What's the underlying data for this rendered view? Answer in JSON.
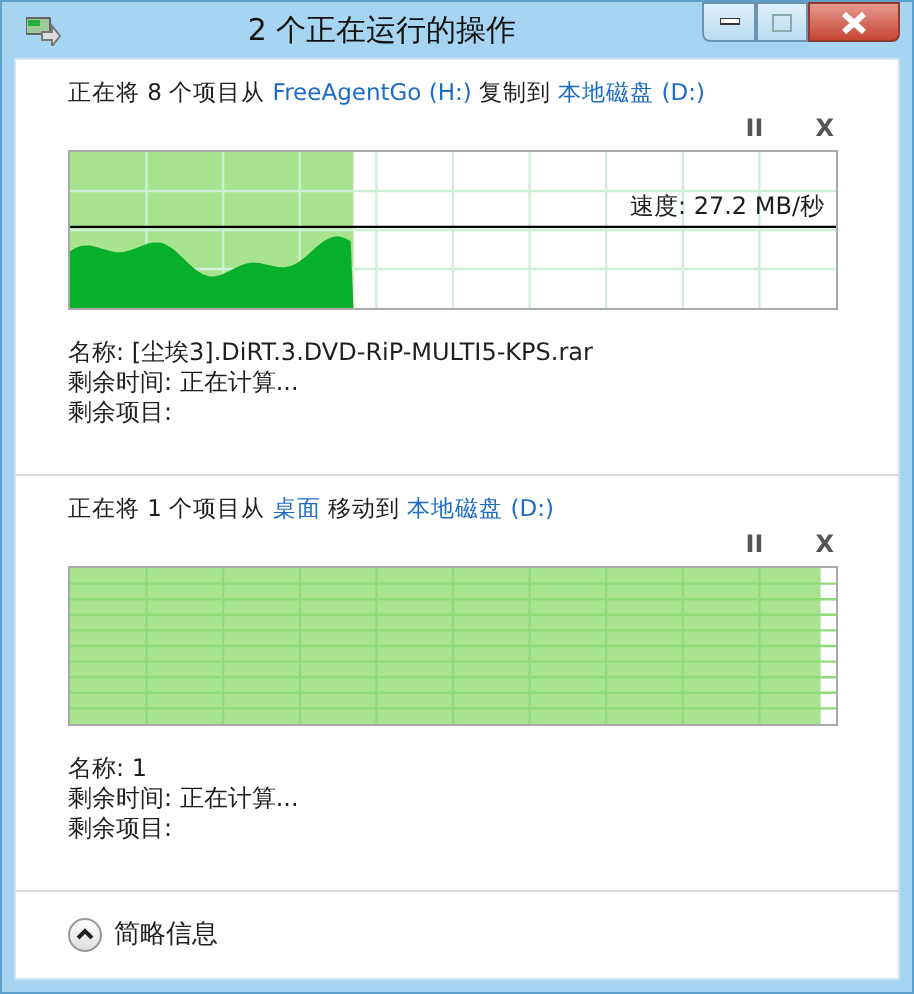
{
  "window": {
    "title": "2 个正在运行的操作"
  },
  "operations": [
    {
      "kind": "graph",
      "title": [
        {
          "text": "正在将 8 个项目从 ",
          "kind": "plain"
        },
        {
          "text": "FreeAgentGo (H:)",
          "kind": "link"
        },
        {
          "text": " 复制到 ",
          "kind": "plain"
        },
        {
          "text": "本地磁盘 (D:)",
          "kind": "link"
        }
      ],
      "pause": "II",
      "cancel": "X",
      "level": 0.37,
      "speed": "速度: 27.2 MB/秒",
      "details": [
        "名称: [尘埃3].DiRT.3.DVD-RiP-MULTI5-KPS.rar",
        "剩余时间: 正在计算...",
        "剩余项目:"
      ]
    },
    {
      "kind": "bar",
      "title": [
        {
          "text": "正在将 1 个项目从 ",
          "kind": "plain"
        },
        {
          "text": "桌面",
          "kind": "link"
        },
        {
          "text": " 移动到 ",
          "kind": "plain"
        },
        {
          "text": "本地磁盘 (D:)",
          "kind": "link"
        }
      ],
      "pause": "II",
      "cancel": "X",
      "level": 0.98,
      "details": [
        "名称: 1",
        "剩余时间: 正在计算...",
        "剩余项目:"
      ]
    }
  ],
  "footer": {
    "label": "简略信息"
  }
}
